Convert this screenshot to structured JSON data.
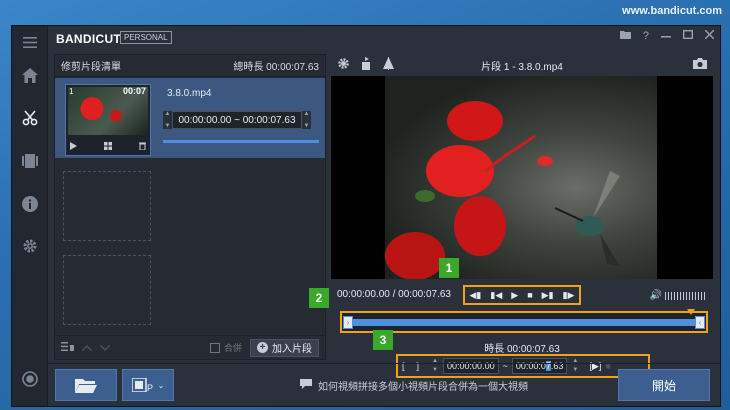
{
  "watermark": "www.bandicut.com",
  "app": {
    "brand_a": "BANDI",
    "brand_b": "CUT",
    "edition": "PERSONAL"
  },
  "sidebar": {
    "items": [
      {
        "icon": "menu-icon"
      },
      {
        "icon": "home-icon"
      },
      {
        "icon": "cut-icon",
        "active": true
      },
      {
        "icon": "film-icon"
      },
      {
        "icon": "info-icon"
      },
      {
        "icon": "settings-icon"
      },
      {
        "icon": "record-icon"
      }
    ]
  },
  "left_panel": {
    "title": "修剪片段清單",
    "total": "總時長 00:00:07.63",
    "clip": {
      "number": "1",
      "duration": "00:07",
      "filename": "3.8.0.mp4",
      "range": "00:00:00.00 ~ 00:00:07.63"
    },
    "merge_label": "合併",
    "add_label": "加入片段"
  },
  "right_panel": {
    "title": "片段 1 - 3.8.0.mp4",
    "current_time": "00:00:00.00 / 00:00:07.63",
    "duration": "時長 00:00:07.63",
    "trim_start": "00:00:00.00",
    "trim_sep": "~",
    "trim_end_a": "00:00:0",
    "trim_end_hl": "7",
    "trim_end_b": ".63"
  },
  "callouts": [
    "1",
    "2",
    "3"
  ],
  "bottom": {
    "hint": "如何視頻拼接多個小視頻片段合併為一個大視頻",
    "start_label": "開始"
  },
  "colors": {
    "accent": "#4f8fe0",
    "highlight": "#f2a11c",
    "callout": "#3aa82a"
  }
}
